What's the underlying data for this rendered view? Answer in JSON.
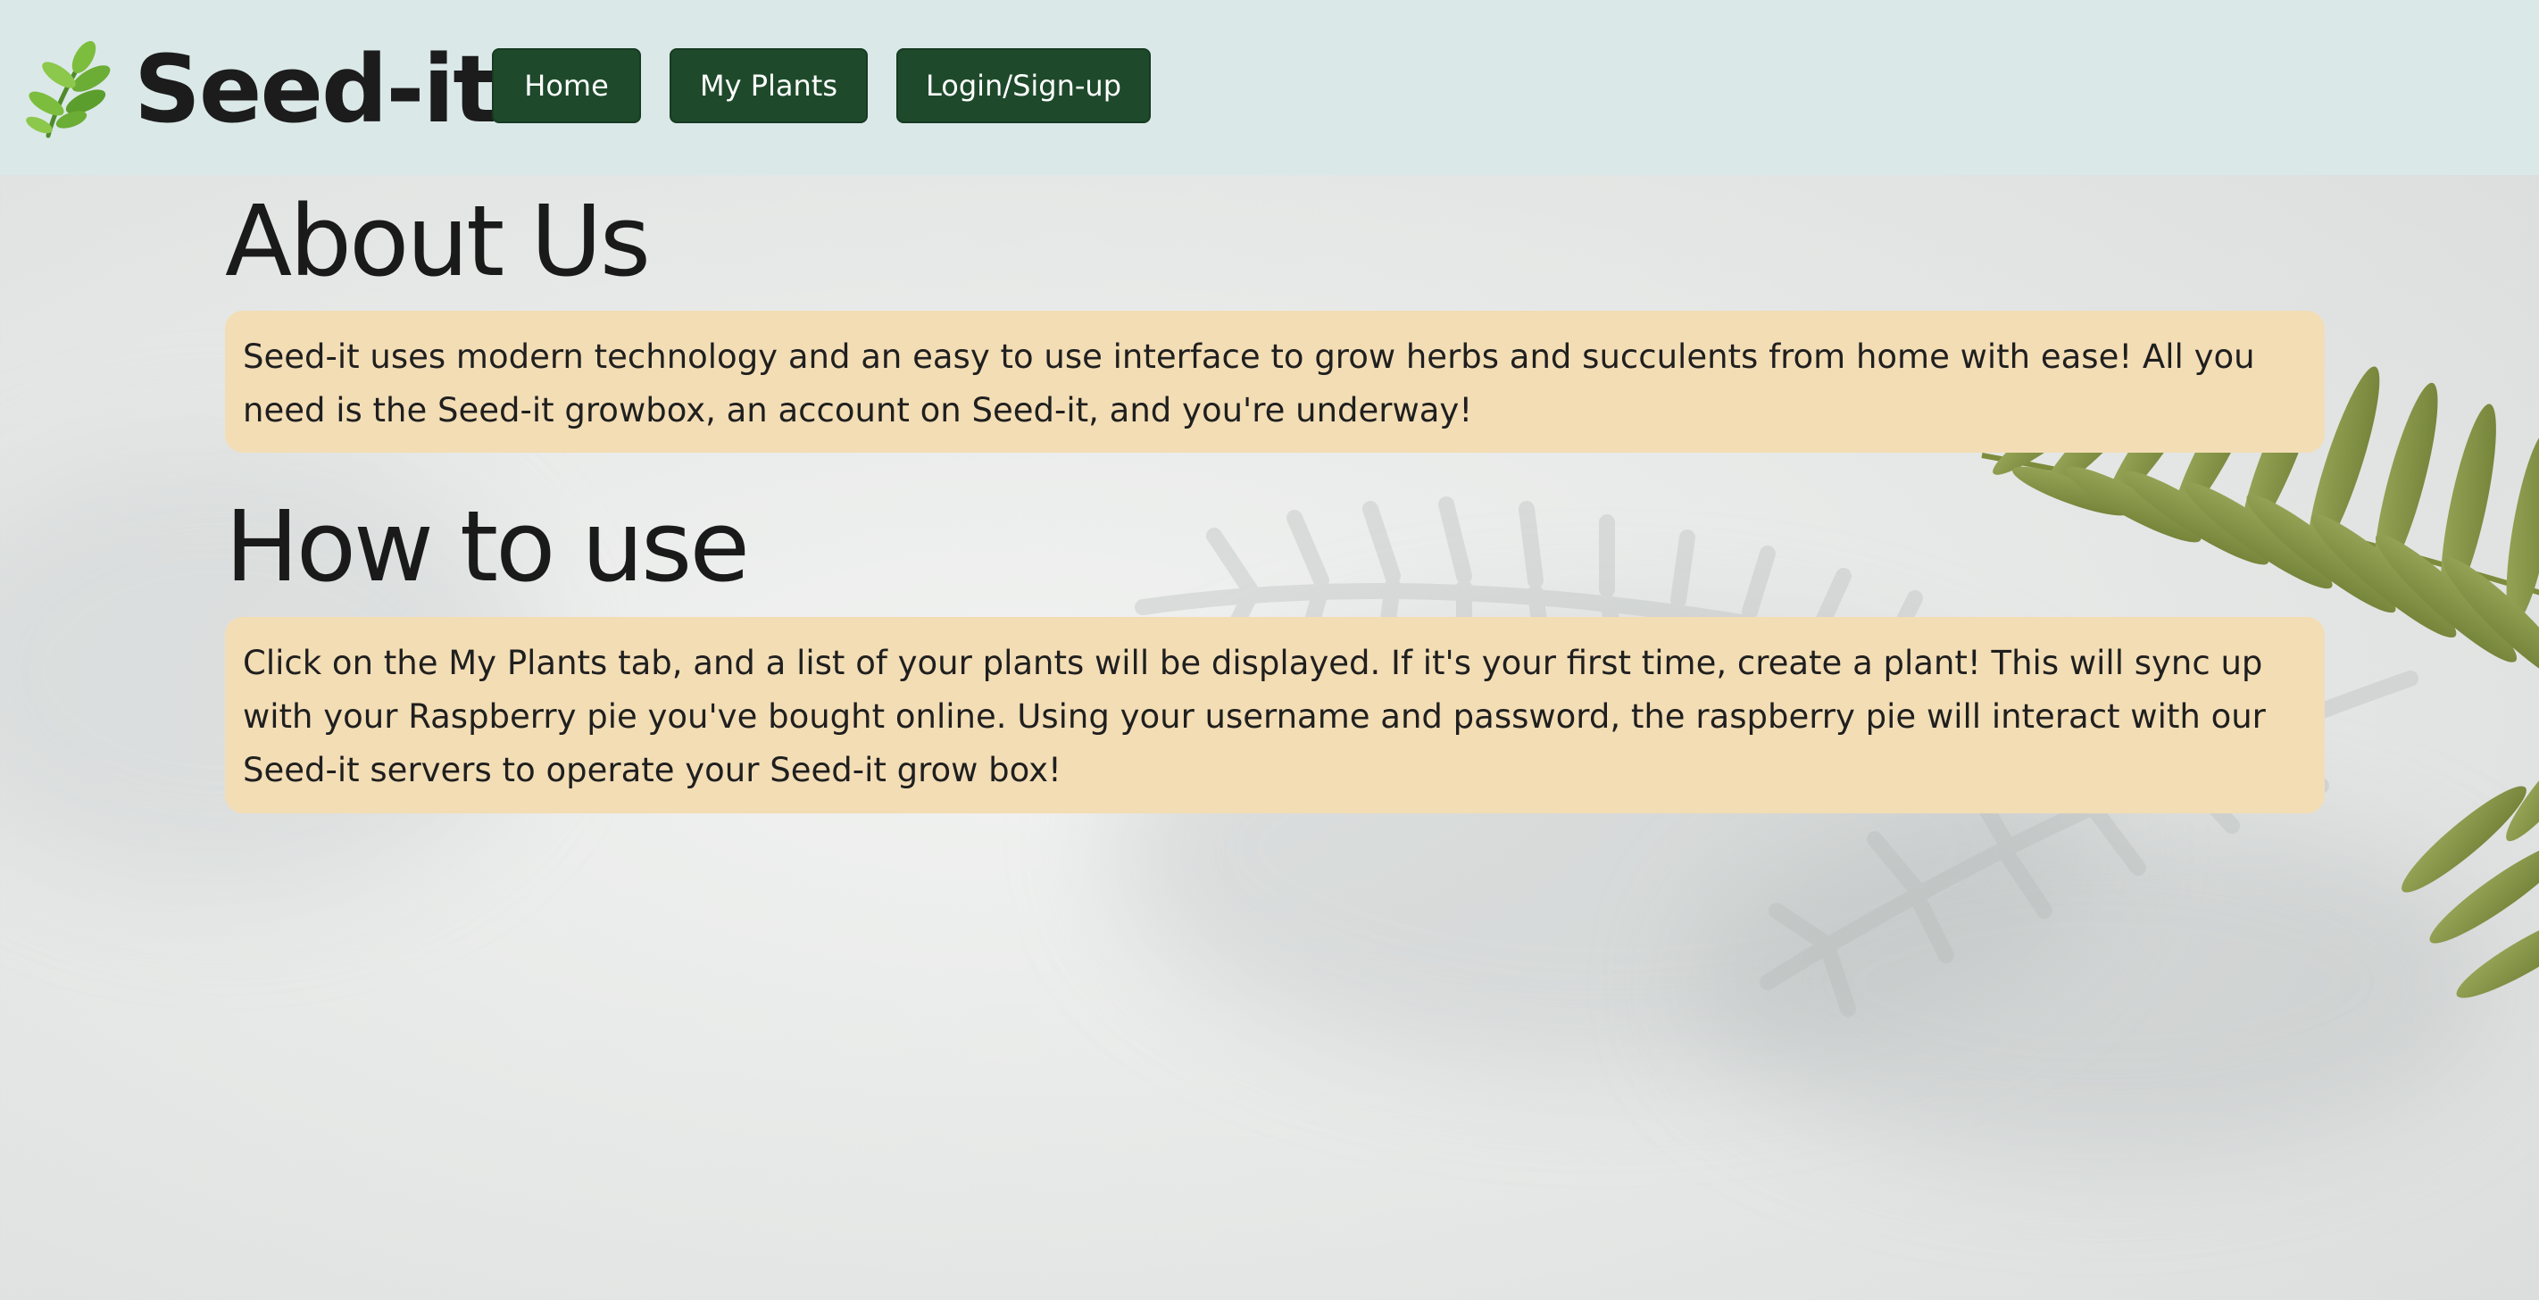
{
  "brand": {
    "name": "Seed-it",
    "icon": "herb-leaf-icon"
  },
  "nav": {
    "home": "Home",
    "my_plants": "My Plants",
    "login": "Login/Sign-up"
  },
  "about": {
    "heading": "About Us",
    "text": "Seed-it uses modern technology and an easy to use interface to grow herbs and succulents from home with ease! All you need is the Seed-it growbox, an account on Seed-it, and you're underway!"
  },
  "how_to": {
    "heading": "How to use",
    "text": "Click on the My Plants tab, and a list of your plants will be displayed. If it's your first time, create a plant! This will sync up with your Raspberry pie you've bought online. Using your username and password, the raspberry pie will interact with our Seed-it servers to operate your Seed-it grow box!"
  },
  "colors": {
    "navbar_bg": "#dbe8e8",
    "button_bg": "#1e4a2b",
    "card_bg": "#f3ddb5",
    "fern": "#8a9a4a"
  }
}
